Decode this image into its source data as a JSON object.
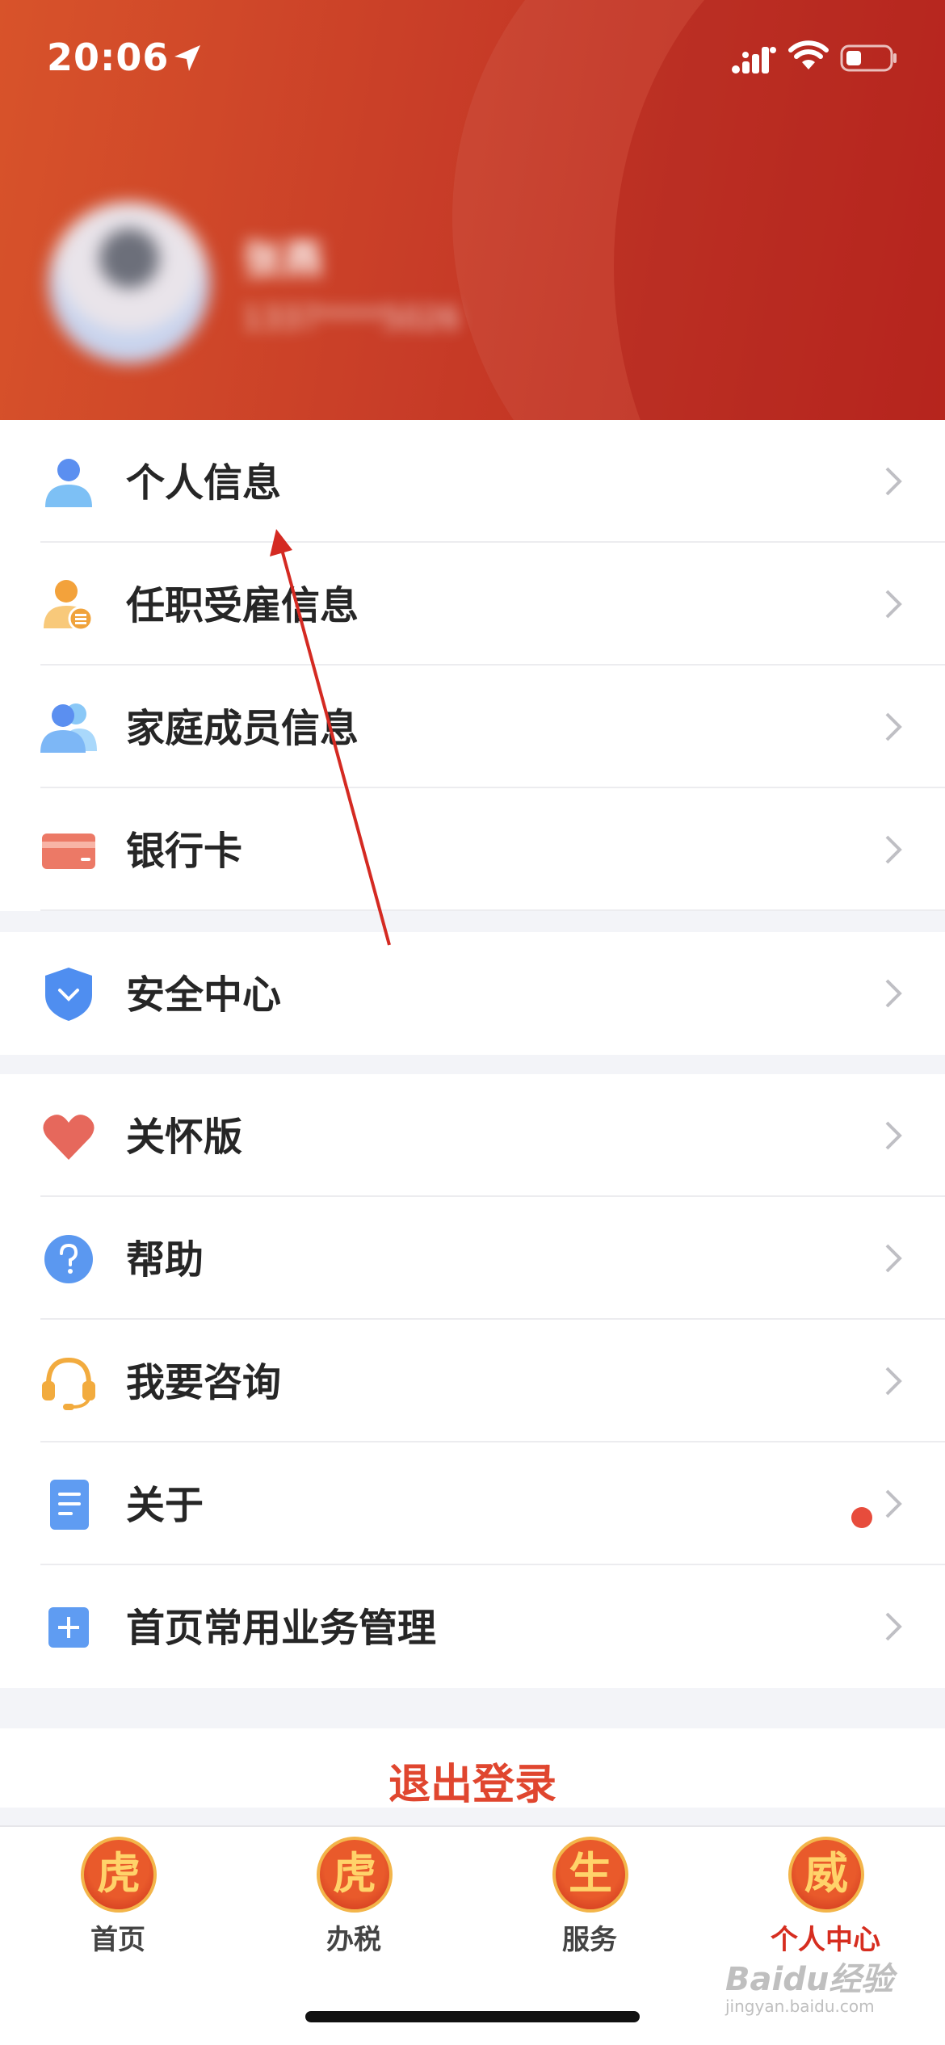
{
  "status_bar": {
    "time": "20:06"
  },
  "profile": {
    "name": "张燕",
    "id_text": "1337****5026"
  },
  "menu_groups": [
    {
      "items": [
        {
          "label": "个人信息"
        },
        {
          "label": "任职受雇信息"
        },
        {
          "label": "家庭成员信息"
        },
        {
          "label": "银行卡"
        }
      ]
    },
    {
      "items": [
        {
          "label": "安全中心"
        }
      ]
    },
    {
      "items": [
        {
          "label": "关怀版"
        },
        {
          "label": "帮助"
        },
        {
          "label": "我要咨询"
        },
        {
          "label": "关于"
        },
        {
          "label": "首页常用业务管理"
        }
      ]
    }
  ],
  "logout_label": "退出登录",
  "tabs": [
    {
      "badge": "虎",
      "label": "首页"
    },
    {
      "badge": "虎",
      "label": "办税"
    },
    {
      "badge": "生",
      "label": "服务"
    },
    {
      "badge": "威",
      "label": "个人中心",
      "active": true
    }
  ],
  "watermark": {
    "brand": "Baidu经验",
    "url": "jingyan.baidu.com"
  },
  "colors": {
    "header_start": "#d8532a",
    "header_end": "#b92219",
    "accent_red": "#e0462f",
    "active_tab": "#d62d1f"
  }
}
